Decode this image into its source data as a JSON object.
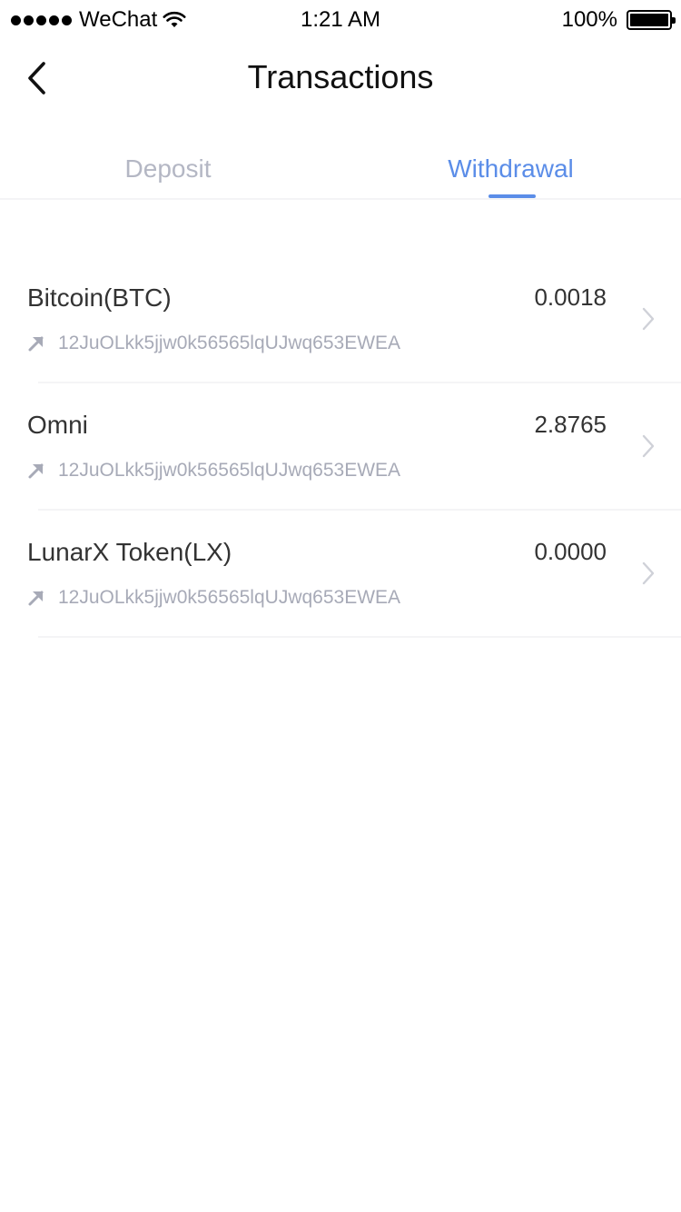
{
  "status_bar": {
    "carrier": "WeChat",
    "time": "1:21 AM",
    "battery": "100%"
  },
  "header": {
    "title": "Transactions"
  },
  "tabs": [
    {
      "label": "Deposit",
      "active": false
    },
    {
      "label": "Withdrawal",
      "active": true
    }
  ],
  "colors": {
    "accent": "#5b8de8",
    "inactive_tab": "#b4b7c4",
    "address_text": "#a7aab7"
  },
  "transactions": [
    {
      "name": "Bitcoin(BTC)",
      "amount": "0.0018",
      "address": "12JuOLkk5jjw0k56565lqUJwq653EWEA",
      "direction_icon": "arrow-up-right-icon"
    },
    {
      "name": "Omni",
      "amount": "2.8765",
      "address": "12JuOLkk5jjw0k56565lqUJwq653EWEA",
      "direction_icon": "arrow-up-right-icon"
    },
    {
      "name": "LunarX Token(LX)",
      "amount": "0.0000",
      "address": "12JuOLkk5jjw0k56565lqUJwq653EWEA",
      "direction_icon": "arrow-up-right-icon"
    }
  ]
}
